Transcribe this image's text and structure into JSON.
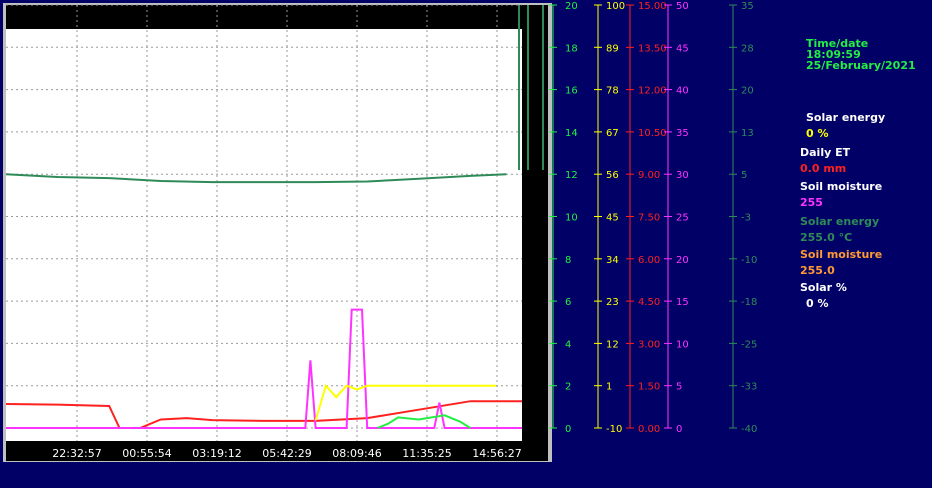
{
  "info_panel": {
    "time_label": "Time/date",
    "time_value": "18:09:59",
    "date_value": "25/February/2021",
    "readouts": [
      {
        "label": "Solar energy",
        "value": "0 %",
        "label_color": "#ffffff",
        "value_color": "#ffff00"
      },
      {
        "label": "Daily ET",
        "value": "0.0 mm",
        "label_color": "#ffffff",
        "value_color": "#ff2020"
      },
      {
        "label": "Soil moisture",
        "value": "255",
        "label_color": "#ffffff",
        "value_color": "#ff33ff"
      },
      {
        "label": "Solar energy",
        "value": "255.0 °C",
        "label_color": "#2e8b57",
        "value_color": "#2e8b57"
      },
      {
        "label": "Soil moisture",
        "value": "255.0",
        "label_color": "#ff9933",
        "value_color": "#ff9933"
      },
      {
        "label": "Solar %",
        "value": "0 %",
        "label_color": "#ffffff",
        "value_color": "#ffffff"
      }
    ]
  },
  "chart_data": {
    "type": "line",
    "x_tick_labels": [
      "22:32:57",
      "00:55:54",
      "03:19:12",
      "05:42:29",
      "08:09:46",
      "11:35:25",
      "14:56:27"
    ],
    "grid": true,
    "axes": [
      {
        "name": "axis-a",
        "color": "#22ee44",
        "ticks": [
          "20",
          "18",
          "16",
          "14",
          "12",
          "10",
          "8",
          "6",
          "4",
          "2",
          "0"
        ]
      },
      {
        "name": "axis-b",
        "color": "#ffff00",
        "ticks": [
          "100",
          "89",
          "78",
          "67",
          "56",
          "45",
          "34",
          "23",
          "12",
          "1",
          "-10"
        ]
      },
      {
        "name": "axis-c",
        "color": "#ff2020",
        "ticks": [
          "15.00",
          "13.50",
          "12.00",
          "10.50",
          "9.00",
          "7.50",
          "6.00",
          "4.50",
          "3.00",
          "1.50",
          "0.00"
        ]
      },
      {
        "name": "axis-d",
        "color": "#ff33ff",
        "ticks": [
          "50",
          "45",
          "40",
          "35",
          "30",
          "25",
          "20",
          "15",
          "10",
          "5",
          "0"
        ]
      },
      {
        "name": "axis-e",
        "color": "#2e8b57",
        "ticks": [
          "35",
          "28",
          "20",
          "13",
          "5",
          "-3",
          "-10",
          "-18",
          "-25",
          "-33",
          "-40"
        ]
      }
    ],
    "series": [
      {
        "color": "#2e8b57",
        "axis": "axis-e",
        "x": [
          0,
          0.1,
          0.2,
          0.3,
          0.4,
          0.5,
          0.6,
          0.7,
          0.8,
          0.9,
          0.97
        ],
        "y": [
          5.0,
          4.5,
          4.3,
          3.8,
          3.6,
          3.6,
          3.6,
          3.7,
          4.2,
          4.7,
          5.0
        ]
      },
      {
        "color": "#ff2020",
        "axis": "axis-c",
        "x": [
          0,
          0.1,
          0.2,
          0.22,
          0.26,
          0.3,
          0.35,
          0.4,
          0.5,
          0.6,
          0.7,
          0.8,
          0.9,
          1.0
        ],
        "y": [
          0.85,
          0.83,
          0.78,
          0.0,
          0.0,
          0.3,
          0.35,
          0.28,
          0.25,
          0.25,
          0.35,
          0.65,
          0.95,
          0.95
        ]
      },
      {
        "color": "#ff33ff",
        "axis": "axis-d",
        "x": [
          0,
          0.58,
          0.59,
          0.6,
          0.66,
          0.67,
          0.68,
          0.69,
          0.7,
          0.8,
          0.83,
          0.84,
          0.85,
          1.0
        ],
        "y": [
          0,
          0,
          8,
          0,
          0,
          14,
          14,
          14,
          0,
          0,
          0,
          3,
          0,
          0
        ]
      },
      {
        "color": "#ffff00",
        "axis": "axis-b",
        "x": [
          0.6,
          0.62,
          0.64,
          0.66,
          0.68,
          0.7,
          0.75,
          0.8,
          0.85,
          0.9,
          0.95
        ],
        "y": [
          -8,
          1,
          -2,
          1,
          0,
          1,
          1,
          1,
          1,
          1,
          1
        ]
      },
      {
        "color": "#22ee44",
        "axis": "axis-a",
        "x": [
          0.72,
          0.74,
          0.76,
          0.8,
          0.85,
          0.88,
          0.9
        ],
        "y": [
          0,
          0.2,
          0.5,
          0.4,
          0.6,
          0.3,
          0
        ]
      }
    ]
  }
}
